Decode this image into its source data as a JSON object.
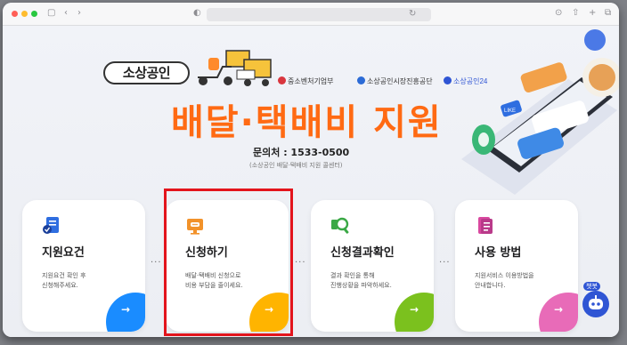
{
  "browser": {
    "address_value": "",
    "colors": {
      "close": "#ff5f57",
      "minimize": "#febc2e",
      "maximize": "#28c840"
    },
    "icons": [
      "sidebar-icon",
      "back-icon",
      "forward-icon",
      "privacy-icon",
      "reload-icon",
      "download-icon",
      "share-icon",
      "new-tab-icon",
      "tabs-overview-icon"
    ]
  },
  "hero": {
    "logo_text": "소상공인",
    "orgs": [
      "중소벤처기업부",
      "소상공인시장진흥공단",
      "소상공인24"
    ],
    "title": "배달·택배비 지원",
    "contact": "문의처 : 1533-0500",
    "contact_sub": "(소상공인 배달·택배비 지원 콜센터)",
    "title_color": "#ff6a13"
  },
  "cards": [
    {
      "title": "지원요건",
      "desc": "지원요건 확인 후\n신청해주세요.",
      "icon": "document-icon",
      "accent": "#1a8cff"
    },
    {
      "title": "신청하기",
      "desc": "배달·택배비 신청으로\n비용 부담을 줄이세요.",
      "icon": "monitor-chat-icon",
      "accent": "#ffb400"
    },
    {
      "title": "신청결과확인",
      "desc": "결과 확인을 통해\n진행상황을 파악하세요.",
      "icon": "magnifier-icon",
      "accent": "#7bc11e"
    },
    {
      "title": "사용 방법",
      "desc": "지원서비스 이용방법을\n안내합니다.",
      "icon": "guide-book-icon",
      "accent": "#e86bb8"
    }
  ],
  "chatbot": {
    "label": "챗봇"
  },
  "highlight_color": "#e3141c"
}
